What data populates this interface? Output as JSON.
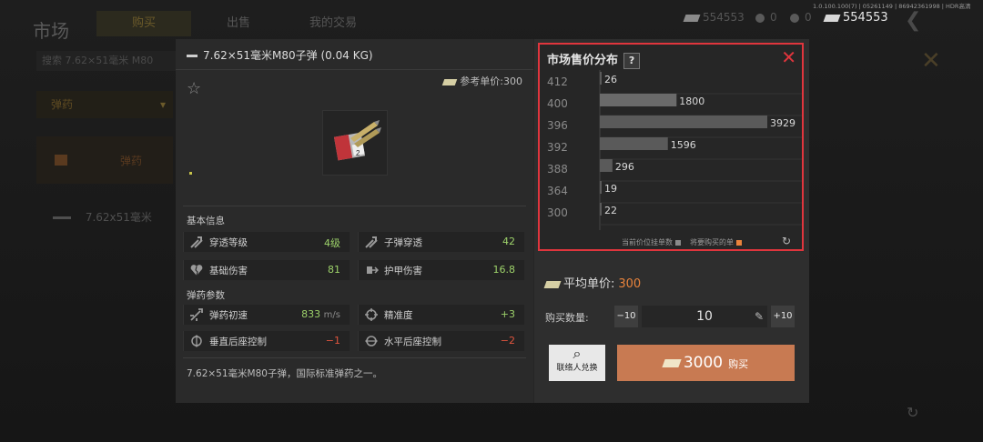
{
  "background": {
    "title": "市场",
    "tabs": [
      "购买",
      "出售",
      "我的交易"
    ],
    "search_text": "搜索 7.62×51毫米 M80",
    "category_select": "弹药",
    "category_item": "弹药",
    "list_item": "7.62x51毫米",
    "close_glyph": "✕",
    "back_glyph": "❮",
    "refresh_glyph": "↻"
  },
  "topbar": {
    "version": "1.0.100.100(7) | 05261149 | 86942361998 | HDR高清",
    "currency_dim": "554553",
    "coin1": "0",
    "coin2": "0",
    "currency_bright": "554553"
  },
  "item": {
    "title": "7.62×51毫米M80子弹 (0.04 KG)",
    "ref_price_label": "参考单价:300",
    "star_glyph": "☆",
    "basic_info_label": "基本信息",
    "stats_basic": [
      {
        "name": "穿透等级",
        "value": "4级",
        "color": "green"
      },
      {
        "name": "子弹穿透",
        "value": "42",
        "color": "green"
      },
      {
        "name": "基础伤害",
        "value": "81",
        "color": "green"
      },
      {
        "name": "护甲伤害",
        "value": "16.8",
        "color": "green"
      }
    ],
    "ammo_params_label": "弹药参数",
    "stats_ammo": [
      {
        "name": "弹药初速",
        "value": "833",
        "unit": "m/s",
        "color": "green"
      },
      {
        "name": "精准度",
        "value": "+3",
        "unit": "",
        "color": "green"
      },
      {
        "name": "垂直后座控制",
        "value": "−1",
        "unit": "",
        "color": "red"
      },
      {
        "name": "水平后座控制",
        "value": "−2",
        "unit": "",
        "color": "red"
      }
    ],
    "description": "7.62×51毫米M80子弹，国际标准弹药之一。"
  },
  "distribution": {
    "title": "市场售价分布",
    "help_glyph": "?",
    "close_glyph": "✕",
    "legend_current": "当前价位挂单数",
    "legend_buy": "将要购买的单",
    "legend_current_color": "#8a8a8a",
    "legend_buy_color": "#e8833c",
    "refresh_glyph": "↻"
  },
  "chart_data": {
    "type": "bar",
    "orientation": "horizontal",
    "categories": [
      "412",
      "400",
      "396",
      "392",
      "388",
      "364",
      "300"
    ],
    "values": [
      26,
      1800,
      3929,
      1596,
      296,
      19,
      22
    ],
    "value_labels": [
      "26",
      "1800",
      "3929",
      "1596",
      "296",
      "19",
      "22"
    ],
    "title": "市场售价分布",
    "xlabel": "",
    "ylabel": "",
    "grid": true,
    "bar_color": "#5a5a5a",
    "highlight_color": "#6a6a6a"
  },
  "purchase": {
    "avg_label": "平均单价:",
    "avg_value": "300",
    "qty_label": "购买数量:",
    "minus_label": "−10",
    "plus_label": "+10",
    "qty_value": "10",
    "pen_glyph": "✎",
    "contact_label": "联络人兑换",
    "buy_amount": "3000",
    "buy_label": "购买"
  }
}
